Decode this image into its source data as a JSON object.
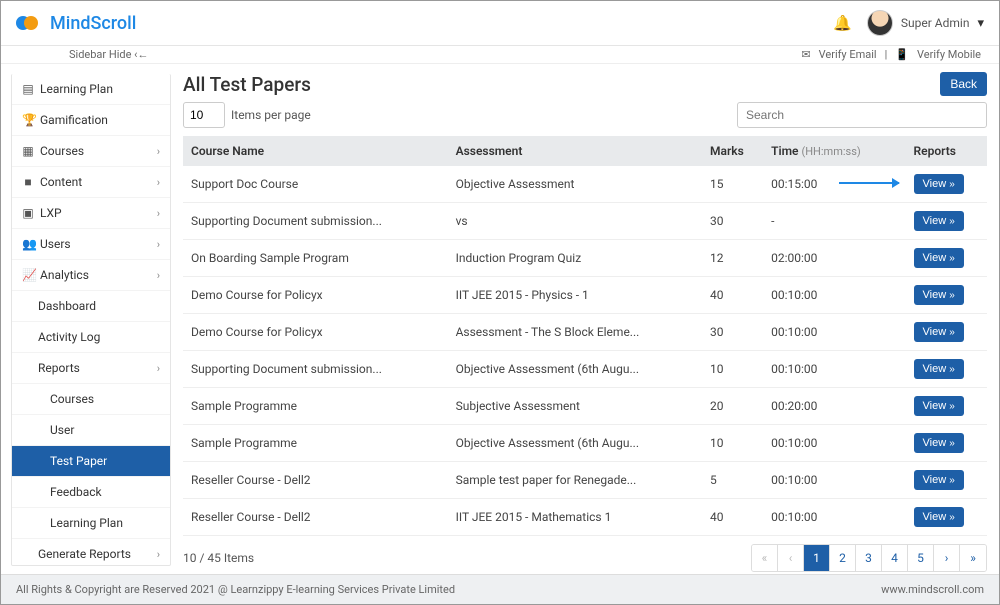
{
  "brand": {
    "name": "MindScroll"
  },
  "header": {
    "user_name": "Super Admin",
    "caret": "▾"
  },
  "secondary": {
    "sidebar_hide": "Sidebar Hide ‹←",
    "verify_email": "Verify Email",
    "verify_mobile": "Verify Mobile",
    "separator": "|"
  },
  "sidebar": {
    "learning_plan": "Learning Plan",
    "gamification": "Gamification",
    "courses": "Courses",
    "content": "Content",
    "lxp": "LXP",
    "users": "Users",
    "analytics": "Analytics",
    "dashboard": "Dashboard",
    "activity_log": "Activity Log",
    "reports": "Reports",
    "reports_courses": "Courses",
    "reports_user": "User",
    "reports_test_paper": "Test Paper",
    "reports_feedback": "Feedback",
    "reports_learning_plan": "Learning Plan",
    "generate_reports": "Generate Reports"
  },
  "page": {
    "title": "All Test Papers",
    "back": "Back",
    "per_page_value": "10",
    "per_page_label": "Items per page",
    "search_placeholder": "Search",
    "view_label": "View",
    "items_count": "10 / 45 Items"
  },
  "columns": {
    "c0": "Course Name",
    "c1": "Assessment",
    "c2": "Marks",
    "c3": "Time",
    "c3_hint": "(HH:mm:ss)",
    "c4": "Reports"
  },
  "rows": [
    {
      "course": "Support Doc Course",
      "assessment": "Objective Assessment",
      "marks": "15",
      "time": "00:15:00"
    },
    {
      "course": "Supporting Document submission...",
      "assessment": "vs",
      "marks": "30",
      "time": "-"
    },
    {
      "course": "On Boarding Sample Program",
      "assessment": "Induction Program Quiz",
      "marks": "12",
      "time": "02:00:00"
    },
    {
      "course": "Demo Course for Policyx",
      "assessment": "IIT JEE 2015 - Physics - 1",
      "marks": "40",
      "time": "00:10:00"
    },
    {
      "course": "Demo Course for Policyx",
      "assessment": "Assessment - The S Block Eleme...",
      "marks": "30",
      "time": "00:10:00"
    },
    {
      "course": "Supporting Document submission...",
      "assessment": "Objective Assessment (6th Augu...",
      "marks": "10",
      "time": "00:10:00"
    },
    {
      "course": "Sample Programme",
      "assessment": "Subjective Assessment",
      "marks": "20",
      "time": "00:20:00"
    },
    {
      "course": "Sample Programme",
      "assessment": "Objective Assessment (6th Augu...",
      "marks": "10",
      "time": "00:10:00"
    },
    {
      "course": "Reseller Course - Dell2",
      "assessment": "Sample test paper for Renegade...",
      "marks": "5",
      "time": "00:10:00"
    },
    {
      "course": "Reseller Course - Dell2",
      "assessment": "IIT JEE 2015 - Mathematics 1",
      "marks": "40",
      "time": "00:10:00"
    }
  ],
  "pagination": {
    "first": "«",
    "prev": "‹",
    "p1": "1",
    "p2": "2",
    "p3": "3",
    "p4": "4",
    "p5": "5",
    "next": "›",
    "last": "»"
  },
  "footer": {
    "copyright": "All Rights & Copyright are Reserved 2021 @ Learnzippy E-learning Services Private Limited",
    "site": "www.mindscroll.com"
  }
}
